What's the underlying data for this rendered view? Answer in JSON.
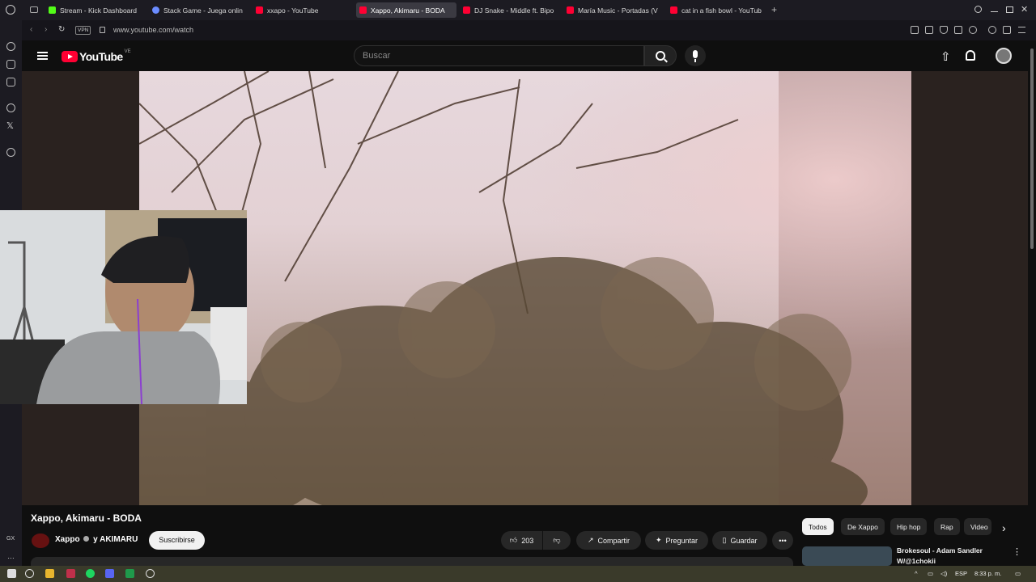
{
  "browser": {
    "tabs": [
      {
        "label": "Stream - Kick Dashboard",
        "icon": "kick-icon",
        "active": false
      },
      {
        "label": "Stack Game - Juega onlin",
        "icon": "globe-icon",
        "active": false
      },
      {
        "label": "xxapo - YouTube",
        "icon": "youtube-icon",
        "active": false
      },
      {
        "label": "Xappo, Akimaru - BODA",
        "icon": "youtube-icon",
        "active": true
      },
      {
        "label": "DJ Snake - Middle ft. Bipo",
        "icon": "youtube-icon",
        "active": false
      },
      {
        "label": "María Music - Portadas (V",
        "icon": "youtube-icon",
        "active": false
      },
      {
        "label": "cat in a fish bowl - YouTub",
        "icon": "youtube-icon",
        "active": false
      }
    ],
    "new_tab": "+",
    "vpn_label": "VPN",
    "url": "www.youtube.com/watch"
  },
  "youtube": {
    "logo_text": "YouTube",
    "country_code": "VE",
    "search_placeholder": "Buscar",
    "video": {
      "title": "Xappo, Akimaru - BODA",
      "channel": "Xappo",
      "channel_joiner": "y AKIMARU",
      "subscribe_label": "Suscribirse",
      "likes": "203",
      "share_label": "Compartir",
      "ask_label": "Preguntar",
      "save_label": "Guardar"
    },
    "chips": [
      "Todos",
      "De Xappo",
      "Hip hop",
      "Rap",
      "Video"
    ],
    "recommendation": {
      "title_line1": "Brokesoul - Adam Sandler",
      "title_line2": "W/@1chokii"
    }
  },
  "sidebar": {
    "gx_label": "GX"
  },
  "taskbar": {
    "lang": "ESP",
    "time": "8:33 p. m."
  },
  "colors": {
    "accent_red": "#ff0033",
    "background": "#0f0f0f"
  }
}
